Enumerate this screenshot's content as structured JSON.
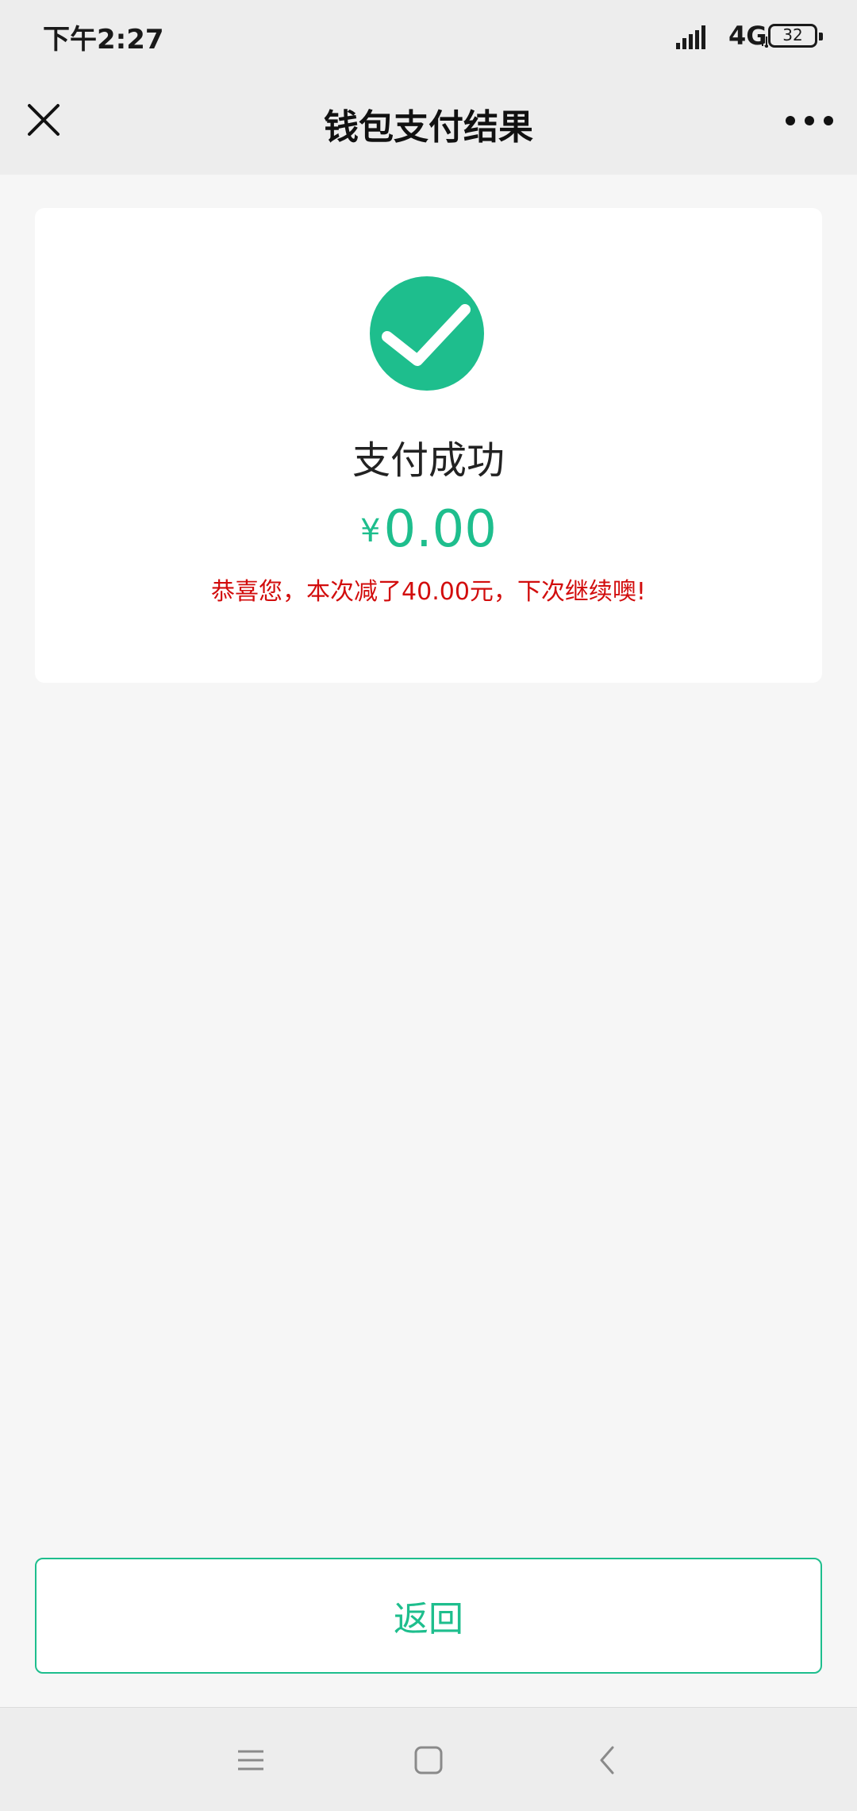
{
  "status_bar": {
    "time": "下午2:27",
    "network": "4G",
    "battery_level": "32",
    "icons": [
      "signal-icon",
      "network-activity-icon",
      "battery-icon"
    ]
  },
  "nav": {
    "title": "钱包支付结果",
    "close_icon": "close-icon",
    "more_icon": "more-icon"
  },
  "result": {
    "icon": "check-circle-icon",
    "title": "支付成功",
    "currency": "¥",
    "amount": "0.00",
    "promo": "恭喜您，本次减了40.00元，下次继续噢!"
  },
  "actions": {
    "back_label": "返回"
  },
  "system_nav": {
    "icons": [
      "menu-icon",
      "home-icon",
      "back-icon"
    ]
  },
  "colors": {
    "accent": "#1ebe8d",
    "promo_text": "#d20d0d",
    "bar_background": "#ededed",
    "page_background": "#f6f6f6"
  }
}
